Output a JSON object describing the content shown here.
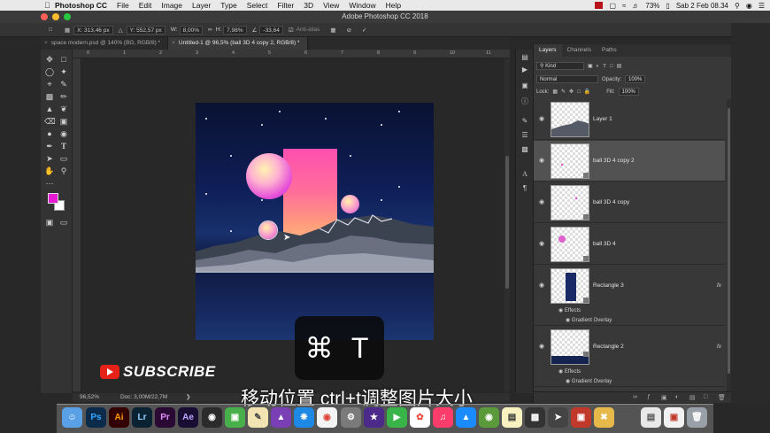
{
  "menubar": {
    "app": "Photoshop CC",
    "items": [
      "File",
      "Edit",
      "Image",
      "Layer",
      "Type",
      "Select",
      "Filter",
      "3D",
      "View",
      "Window",
      "Help"
    ],
    "battery": "73%",
    "clock": "Sab 2 Feb 08.34"
  },
  "window_title": "Adobe Photoshop CC 2018",
  "options": {
    "x": "X: 313,46 px",
    "y": "Y: 552,57 px",
    "w_label": "W:",
    "w": "8,00%",
    "h_label": "H:",
    "h": "7,98%",
    "angle": "-33,64",
    "antialias": "Anti-alias"
  },
  "tabs": [
    {
      "label": "space modern.psd @ 140% (BG, RGB/8) *"
    },
    {
      "label": "Untitled-1 @ 96,5% (ball 3D 4 copy 2, RGB/8) *"
    }
  ],
  "ruler_ticks": [
    "0",
    "1",
    "2",
    "3",
    "4",
    "5",
    "6",
    "7",
    "8",
    "9",
    "10",
    "11"
  ],
  "status": {
    "zoom": "96,52%",
    "doc": "Doc: 3,00M/22,7M"
  },
  "layers_panel": {
    "tabs": [
      "Layers",
      "Channels",
      "Paths"
    ],
    "kind": "Kind",
    "blend_mode": "Normal",
    "opacity_label": "Opacity:",
    "opacity": "100%",
    "lock_label": "Lock:",
    "fill_label": "Fill:",
    "fill": "100%",
    "layers": [
      {
        "name": "Layer 1"
      },
      {
        "name": "ball 3D 4 copy 2"
      },
      {
        "name": "ball 3D 4 copy"
      },
      {
        "name": "ball 3D 4"
      },
      {
        "name": "Rectangle 3",
        "fx": "fx",
        "effects": "Effects",
        "effect_item": "Gradient Overlay"
      },
      {
        "name": "Rectangle 2",
        "fx": "fx",
        "effects": "Effects",
        "effect_item": "Gradient Overlay"
      }
    ]
  },
  "overlay": {
    "shortcut": "⌘ T",
    "subscribe": "SUBSCRIBE",
    "caption": "移动位置 ctrl+t调整图片大小"
  },
  "dock": {
    "apps": [
      "Ps",
      "Ai",
      "Lr",
      "Pr",
      "Ae"
    ]
  },
  "colors": {
    "foreground": "#e61ad2",
    "background": "#ffffff",
    "youtube_red": "#e62117"
  }
}
